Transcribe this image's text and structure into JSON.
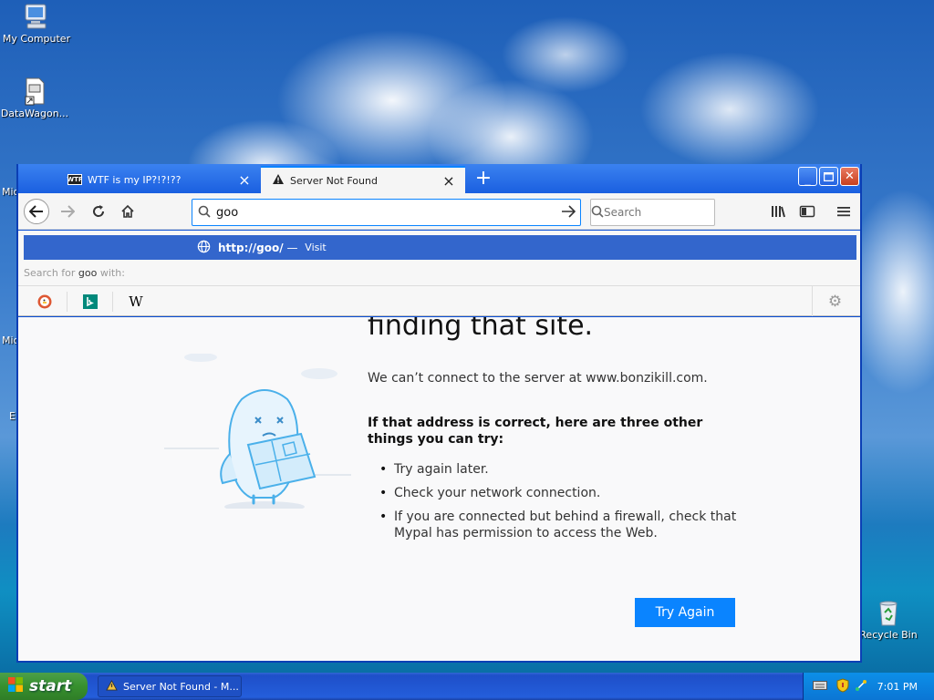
{
  "desktop": {
    "icons": [
      {
        "label": "My Computer"
      },
      {
        "label": "DataWagon..."
      },
      {
        "label": "Recycle Bin"
      }
    ],
    "partial_labels": [
      "Mic",
      "Mic",
      "E"
    ]
  },
  "browser": {
    "tabs": [
      {
        "title": "WTF is my IP?!?!??",
        "favicon": "WTF",
        "active": false
      },
      {
        "title": "Server Not Found",
        "active": true
      }
    ],
    "url_input": "goo",
    "search_placeholder": "Search",
    "suggestion": {
      "url": "http://goo/",
      "dash": " — ",
      "action": "Visit"
    },
    "search_with": {
      "prefix": "Search for ",
      "query": "goo",
      "suffix": " with:"
    },
    "engines": [
      "DuckDuckGo",
      "Bing",
      "W"
    ]
  },
  "page": {
    "heading": "finding that site.",
    "description": "We can’t connect to the server at www.bonzikill.com.",
    "tips_title": "If that address is correct, here are three other things you can try:",
    "tips": [
      "Try again later.",
      "Check your network connection.",
      "If you are connected but behind a firewall, check that Mypal has permission to access the Web."
    ],
    "button": "Try Again"
  },
  "taskbar": {
    "start_label": "start",
    "task_label": "Server Not Found - M...",
    "clock": "7:01 PM"
  },
  "colors": {
    "accent": "#0a84ff",
    "suggestion_bg": "#3366cc",
    "xp_title": "#0a4fd6"
  }
}
